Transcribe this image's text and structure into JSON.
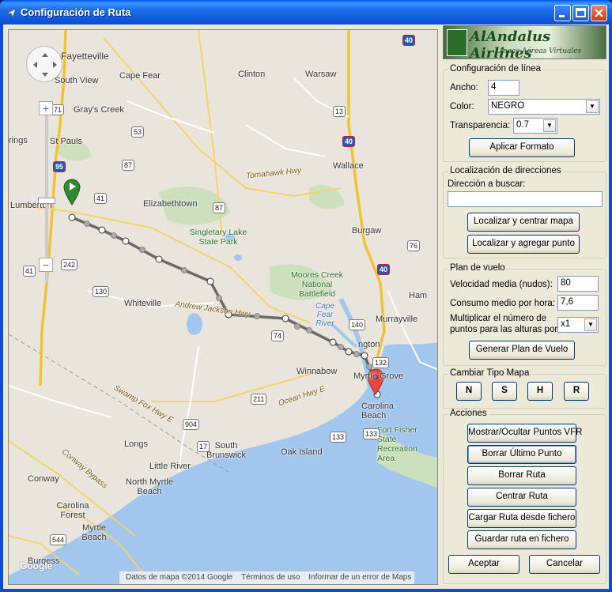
{
  "window": {
    "title": "Configuración de Ruta",
    "controls": [
      "minimize-icon",
      "maximize-icon",
      "close-icon"
    ]
  },
  "map": {
    "places": [
      {
        "name": "Fayetteville"
      },
      {
        "name": "South View"
      },
      {
        "name": "Cape Fear"
      },
      {
        "name": "Clinton"
      },
      {
        "name": "Warsaw"
      },
      {
        "name": "Gray's Creek"
      },
      {
        "name": "St Pauls"
      },
      {
        "name": "rings"
      },
      {
        "name": "Wallace"
      },
      {
        "name": "Lumberton"
      },
      {
        "name": "Elizabethtown"
      },
      {
        "name": "Burgaw"
      },
      {
        "name": "Whiteville"
      },
      {
        "name": "Murrayville"
      },
      {
        "name": "Winnabow"
      },
      {
        "name": "Myrtle Grove"
      },
      {
        "name": "Carolina Beach"
      },
      {
        "name": "Longs"
      },
      {
        "name": "Little River"
      },
      {
        "name": "North Myrtle Beach"
      },
      {
        "name": "Conway"
      },
      {
        "name": "Carolina Forest"
      },
      {
        "name": "Myrtle Beach"
      },
      {
        "name": "Burgess"
      },
      {
        "name": "Oak Island"
      },
      {
        "name": "South Brunswick"
      },
      {
        "name": "Ham"
      },
      {
        "name": "ngton"
      }
    ],
    "parks": [
      {
        "name": "Singletary Lake State Park"
      },
      {
        "name": "Moores Creek National Battlefield"
      },
      {
        "name": "Fort Fisher State Recreation Area"
      }
    ],
    "waters": [
      {
        "name": "Cape Fear River"
      }
    ],
    "roads": [
      {
        "name": "Tomahawk Hwy"
      },
      {
        "name": "Andrew Jackson Hwy"
      },
      {
        "name": "Ocean Hwy E"
      },
      {
        "name": "Swamp Fox Hwy E"
      },
      {
        "name": "Conway Bypass"
      }
    ],
    "shields": [
      "71",
      "95",
      "53",
      "87",
      "41",
      "41",
      "87",
      "242",
      "40",
      "40",
      "40",
      "130",
      "74",
      "140",
      "132",
      "133",
      "211",
      "904",
      "17",
      "133",
      "544",
      "13",
      "76"
    ],
    "attribution": [
      "Datos de mapa ©2014 Google",
      "Términos de uso",
      "Informar de un error de Maps"
    ],
    "google_logo": "Google",
    "zoom_in": "+",
    "zoom_out": "−"
  },
  "logo": {
    "title": "AlAndalus Airlines",
    "subtitle": "Líneas Aéreas Virtuales"
  },
  "config_linea": {
    "title": "Configuración de línea",
    "ancho_label": "Ancho:",
    "ancho_value": "4",
    "color_label": "Color:",
    "color_value": "NEGRO",
    "transparencia_label": "Transparencia:",
    "transparencia_value": "0.7",
    "aplicar_label": "Aplicar Formato"
  },
  "localizacion": {
    "title": "Localización de direcciones",
    "direccion_label": "Dirección a buscar:",
    "direccion_value": "",
    "localizar_centrar_label": "Localizar y centrar mapa",
    "localizar_agregar_label": "Localizar y agregar punto"
  },
  "plan_vuelo": {
    "title": "Plan de vuelo",
    "velocidad_label": "Velocidad media (nudos):",
    "velocidad_value": "80",
    "consumo_label": "Consumo medio por hora:",
    "consumo_value": "7,6",
    "multiplicar_label_1": "Multiplicar el número de",
    "multiplicar_label_2": "puntos para las alturas por:",
    "multiplicar_value": "x1",
    "generar_label": "Generar Plan de Vuelo"
  },
  "tipo_mapa": {
    "title": "Cambiar Tipo Mapa",
    "buttons": [
      "N",
      "S",
      "H",
      "R"
    ]
  },
  "acciones": {
    "title": "Acciones",
    "buttons": [
      "Mostrar/Ocultar Puntos VFR",
      "Borrar Último Punto",
      "Borrar Ruta",
      "Centrar Ruta",
      "Cargar Ruta desde fichero",
      "Guardar ruta en fichero"
    ]
  },
  "footer": {
    "aceptar_label": "Aceptar",
    "cancelar_label": "Cancelar"
  },
  "colors": {
    "titlebar": "#0a53d8",
    "client_bg": "#ece9d8",
    "route": "#444444",
    "start_marker": "#2e8b2e",
    "end_marker": "#e8463c",
    "water": "#a3c6ee"
  }
}
